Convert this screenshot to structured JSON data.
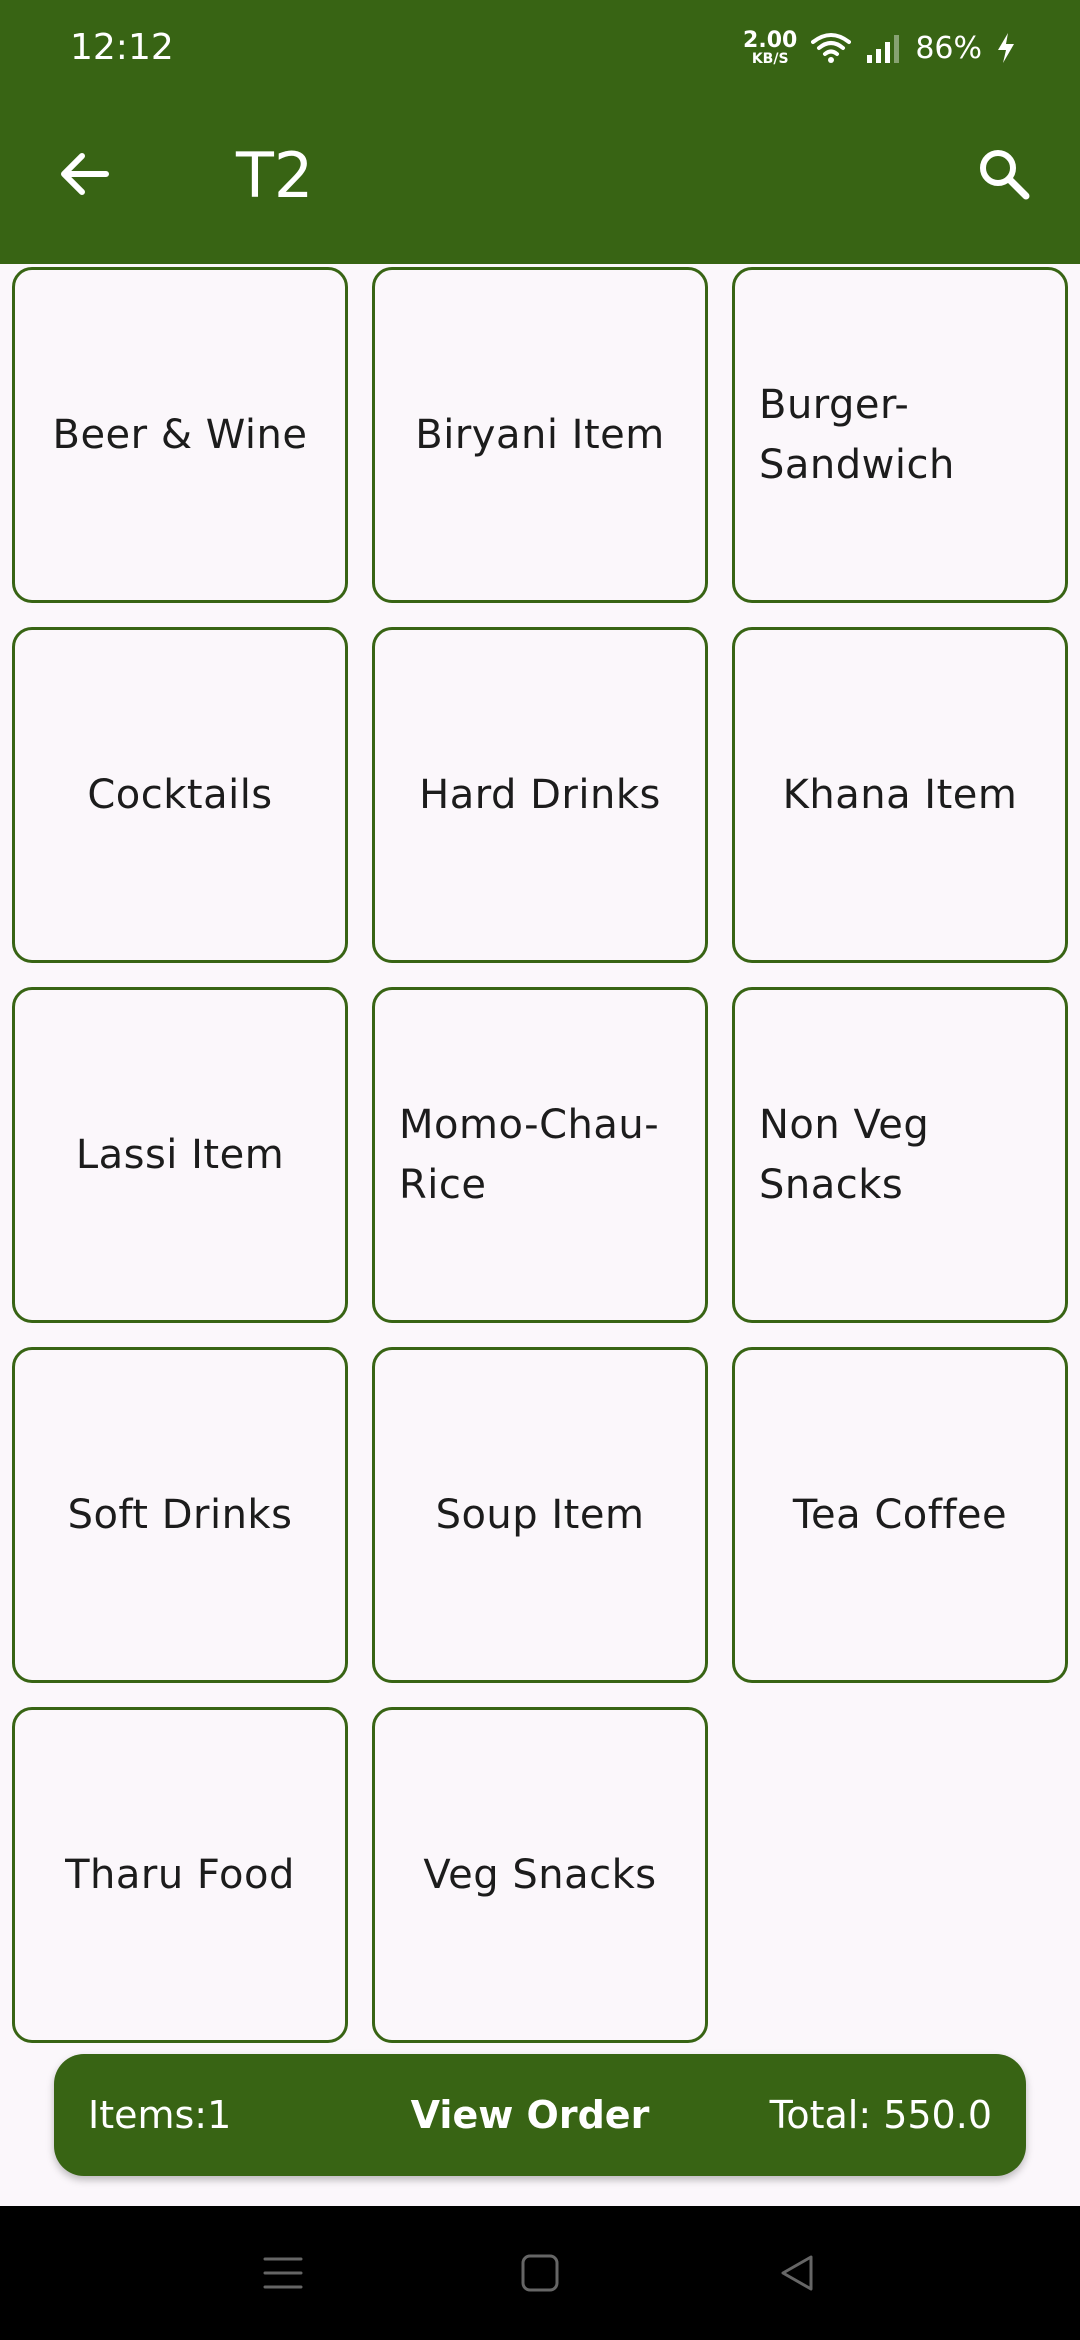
{
  "status_bar": {
    "time": "12:12",
    "net_speed_value": "2.00",
    "net_speed_unit": "KB/S",
    "battery": "86%"
  },
  "app_bar": {
    "title": "T2",
    "back_icon": "arrow-back-icon",
    "search_icon": "search-icon"
  },
  "categories": [
    {
      "label": "Beer & Wine"
    },
    {
      "label": "Biryani Item"
    },
    {
      "label": "Burger-Sandwich"
    },
    {
      "label": "Cocktails"
    },
    {
      "label": "Hard Drinks"
    },
    {
      "label": "Khana Item"
    },
    {
      "label": "Lassi Item"
    },
    {
      "label": "Momo-Chau-Rice"
    },
    {
      "label": "Non Veg Snacks"
    },
    {
      "label": "Soft Drinks"
    },
    {
      "label": "Soup Item"
    },
    {
      "label": "Tea Coffee"
    },
    {
      "label": "Tharu Food"
    },
    {
      "label": "Veg Snacks"
    }
  ],
  "order_bar": {
    "items": "Items:1",
    "view_order": "View Order",
    "total": "Total: 550.0"
  },
  "colors": {
    "primary": "#386414",
    "background": "#fbf7fb",
    "text": "#1c1c1c"
  }
}
